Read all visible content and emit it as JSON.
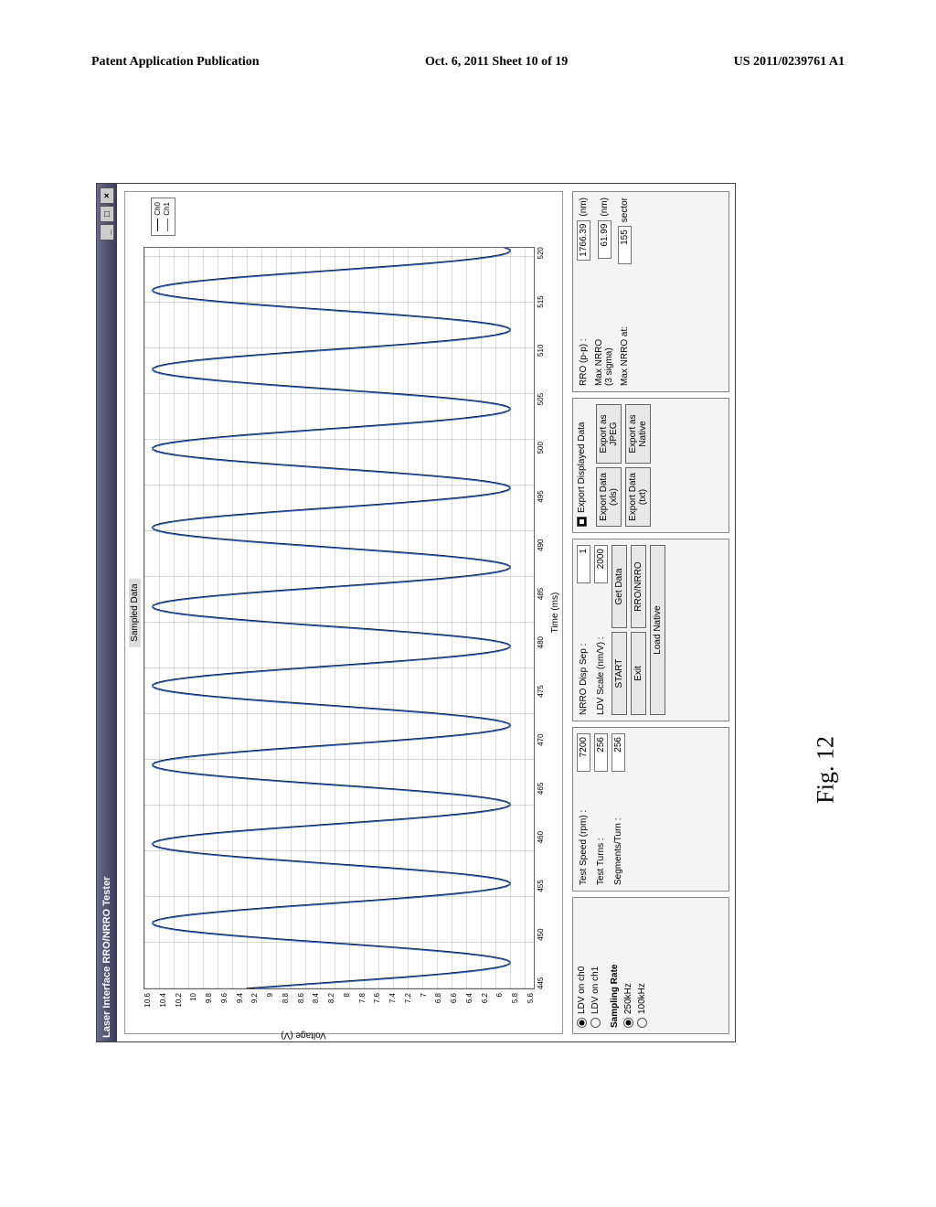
{
  "header": {
    "left": "Patent Application Publication",
    "center": "Oct. 6, 2011   Sheet 10 of 19",
    "right": "US 2011/0239761 A1"
  },
  "figure_label": "Fig. 12",
  "window": {
    "title": "Laser Interface RRO/NRRO Tester",
    "min": "_",
    "max": "□",
    "close": "×"
  },
  "chart_data": {
    "type": "line",
    "title": "Sampled Data",
    "xlabel": "Time (ms)",
    "ylabel": "Voltage (V)",
    "x_ticks": [
      "445",
      "450",
      "455",
      "460",
      "465",
      "470",
      "475",
      "480",
      "485",
      "490",
      "495",
      "500",
      "505",
      "510",
      "515",
      "520"
    ],
    "y_ticks": [
      "10.6",
      "10.4",
      "10.2",
      "10",
      "9.8",
      "9.6",
      "9.4",
      "9.2",
      "9",
      "8.8",
      "8.6",
      "8.4",
      "8.2",
      "8",
      "7.8",
      "7.6",
      "7.4",
      "7.2",
      "7",
      "6.8",
      "6.6",
      "6.4",
      "6.2",
      "6",
      "5.8",
      "5.6"
    ],
    "xlim": [
      445,
      523
    ],
    "ylim": [
      5.6,
      10.6
    ],
    "series": [
      {
        "name": "Ch0",
        "color": "#000",
        "period_ms": 8.33,
        "amplitude_v": 2.3,
        "offset_v": 8.2,
        "phase": 0
      },
      {
        "name": "Ch1",
        "color": "#36c",
        "period_ms": 8.33,
        "amplitude_v": 2.3,
        "offset_v": 8.2,
        "phase": 0.05
      }
    ],
    "legend": [
      "Ch0",
      "Ch1"
    ]
  },
  "controls": {
    "ldv": {
      "ch0_label": "LDV on ch0",
      "ch1_label": "LDV on ch1",
      "selected": "ch0",
      "sampling_label": "Sampling Rate",
      "rate_250": "250kHz",
      "rate_100": "100kHz",
      "rate_selected": "250kHz"
    },
    "test": {
      "speed_label": "Test Speed (rpm) :",
      "speed_value": "7200",
      "turns_label": "Test Turns :",
      "turns_value": "256",
      "segs_label": "Segments/Turn :",
      "segs_value": "256"
    },
    "disp": {
      "sep_label": "NRRO Disp Sep :",
      "sep_value": "1",
      "scale_label": "LDV Scale (nm/V) :",
      "scale_value": "2000",
      "start": "START",
      "exit": "Exit",
      "get_data": "Get Data",
      "rro_nrro": "RRO/NRRO",
      "load_native": "Load Native"
    },
    "export": {
      "check_label": "Export Displayed Data",
      "check_on": true,
      "btn_xls": "Export Data (xls)",
      "btn_jpeg": "Export as JPEG",
      "btn_txt": "Export Data (txt)",
      "btn_native": "Export as Native"
    },
    "results": {
      "rro_label": "RRO (p-p) :",
      "rro_value": "1766.39",
      "rro_unit": "(nm)",
      "max_nrro_label": "Max NRRO\n(3 sigma)",
      "max_nrro_value": "61.99",
      "max_nrro_unit": "(nm)",
      "at_label": "Max NRRO at:",
      "at_value": "155",
      "at_unit": "sector"
    }
  }
}
